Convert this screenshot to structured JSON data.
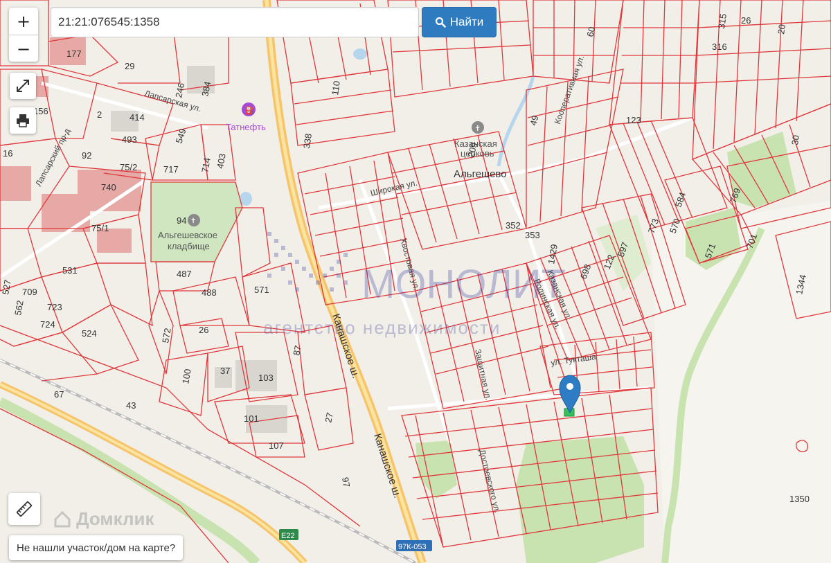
{
  "search": {
    "value": "21:21:076545:1358",
    "button_label": "Найти"
  },
  "controls": {
    "zoom_in": "+",
    "zoom_out": "−"
  },
  "footer": {
    "not_found_label": "Не нашли участок/дом на карте?",
    "domclick_logo": "Домклик"
  },
  "watermark": {
    "title": "МОНОЛИТ",
    "subtitle": "агентство недвижимости"
  },
  "map": {
    "village": "Альгешево",
    "cemetery": "Альгешевское кладбище",
    "gas_station": "Татнефть",
    "church": "Казанская церковь",
    "roads": {
      "kanashskoe_1": "Канашское ш.",
      "kanashskoe_2": "Канашское ш.",
      "lapsarskiy": "Лапсарский пр-д",
      "lapsarskaya": "Лапсарская ул.",
      "shirokaya": "Широкая ул.",
      "kazanskaya": "Казанская ул.",
      "tuktasha": "ул. Тукташа",
      "khvostovaya": "Хвостовая ул.",
      "rodina": "Родинская ул.",
      "zaschitnaya": "Защитная ул.",
      "dostoevskogo": "Достоевского ул.",
      "kooperativnaya": "Кооперативная ул."
    },
    "route_shields": {
      "e": "E22",
      "regional": "97К-053"
    },
    "parcels": {
      "p177": "177",
      "p29": "29",
      "p246": "246",
      "p384": "384",
      "p156": "156",
      "p2": "2",
      "p414": "414",
      "p493": "493",
      "p549": "549",
      "p16": "16",
      "p92": "92",
      "p75_2": "75/2",
      "p740": "740",
      "p717": "717",
      "p714": "714",
      "p403": "403",
      "p75_1": "75/1",
      "p94": "94",
      "p531": "531",
      "p487": "487",
      "p488": "488",
      "p571a": "571",
      "p709": "709",
      "p723": "723",
      "p562": "562",
      "p527": "527",
      "p724": "724",
      "p524": "524",
      "p572": "572",
      "p26": "26",
      "p100": "100",
      "p37": "37",
      "p103": "103",
      "p87": "87",
      "p101": "101",
      "p27": "27",
      "p107": "107",
      "p67": "67",
      "p43": "43",
      "p97": "97",
      "p110": "110",
      "p338": "338",
      "p352": "352",
      "p353": "353",
      "p1429": "1429",
      "p698": "698",
      "p122": "122",
      "p597": "597",
      "p773": "773",
      "p570": "570",
      "p584": "584",
      "p571b": "571",
      "p769": "769",
      "p701": "701",
      "p49": "49",
      "p123": "123",
      "p1344": "1344",
      "p1350": "1350",
      "p60": "60",
      "p209": "209",
      "p315": "315",
      "p316": "316",
      "p26b": "26",
      "p20": "20",
      "p30": "30"
    }
  },
  "colors": {
    "parcel": "#e0373b",
    "accent": "#2f7bbf",
    "green": "#c8e3b0"
  }
}
